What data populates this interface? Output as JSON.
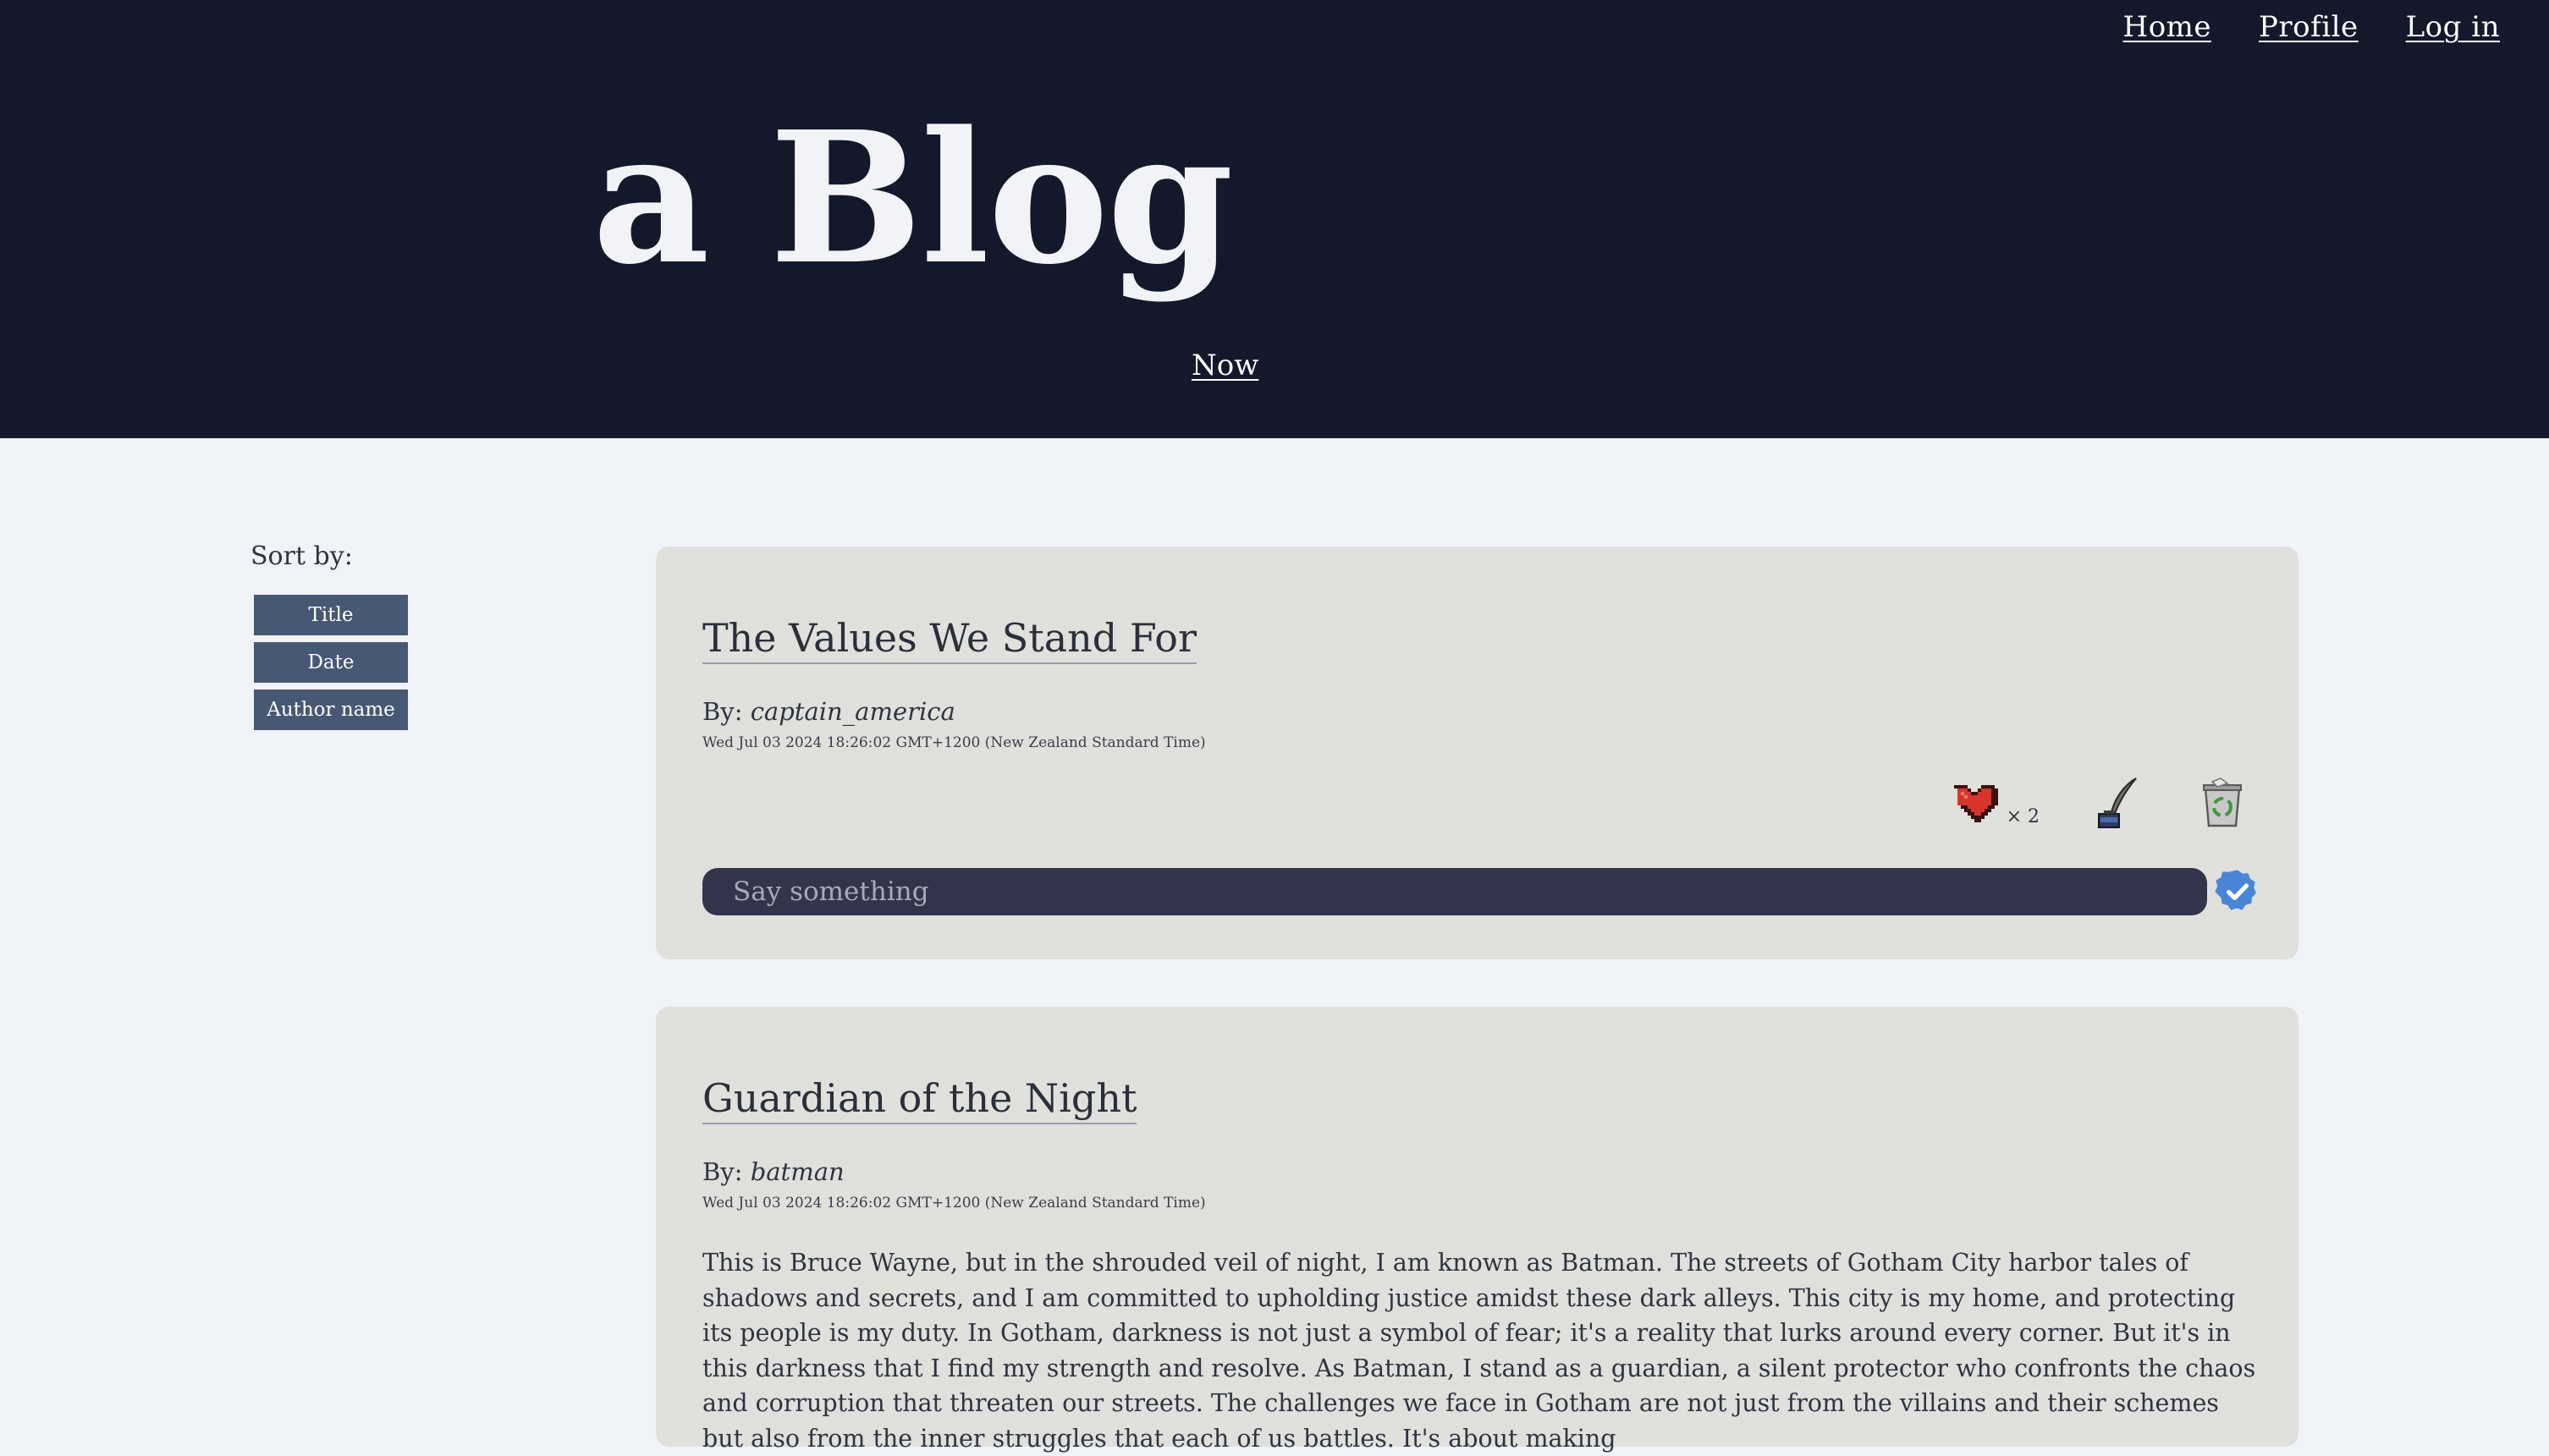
{
  "nav": {
    "home": "Home",
    "profile": "Profile",
    "login": "Log in"
  },
  "header": {
    "title": "a Blog",
    "now_link": "Now"
  },
  "sidebar": {
    "sort_label": "Sort by:",
    "sort_options": [
      "Title",
      "Date",
      "Author name"
    ]
  },
  "posts": [
    {
      "title": "The Values We Stand For",
      "by_label": "By:",
      "author": "captain_america",
      "timestamp": "Wed Jul 03 2024 18:26:02 GMT+1200 (New Zealand Standard Time)",
      "likes": "× 2",
      "comment_placeholder": "Say something",
      "icons": {
        "like": "heart-icon",
        "edit": "quill-inkwell-icon",
        "delete": "recycle-bin-icon",
        "submit": "check-badge-icon"
      }
    },
    {
      "title": "Guardian of the Night",
      "by_label": "By:",
      "author": "batman",
      "timestamp": "Wed Jul 03 2024 18:26:02 GMT+1200 (New Zealand Standard Time)",
      "body": "This is Bruce Wayne, but in the shrouded veil of night, I am known as Batman. The streets of Gotham City harbor tales of shadows and secrets, and I am committed to upholding justice amidst these dark alleys. This city is my home, and protecting its people is my duty. In Gotham, darkness is not just a symbol of fear; it's a reality that lurks around every corner. But it's in this darkness that I find my strength and resolve. As Batman, I stand as a guardian, a silent protector who confronts the chaos and corruption that threaten our streets. The challenges we face in Gotham are not just from the villains and their schemes but also from the inner struggles that each of us battles. It's about making"
    }
  ],
  "colors": {
    "header_bg": "#14182b",
    "page_bg": "#f0f3f8",
    "card_bg": "#e0e0dc",
    "button_bg": "#475874",
    "input_bg": "#31344a",
    "accent_blue": "#4a86d8",
    "heart_red": "#d8352a"
  }
}
